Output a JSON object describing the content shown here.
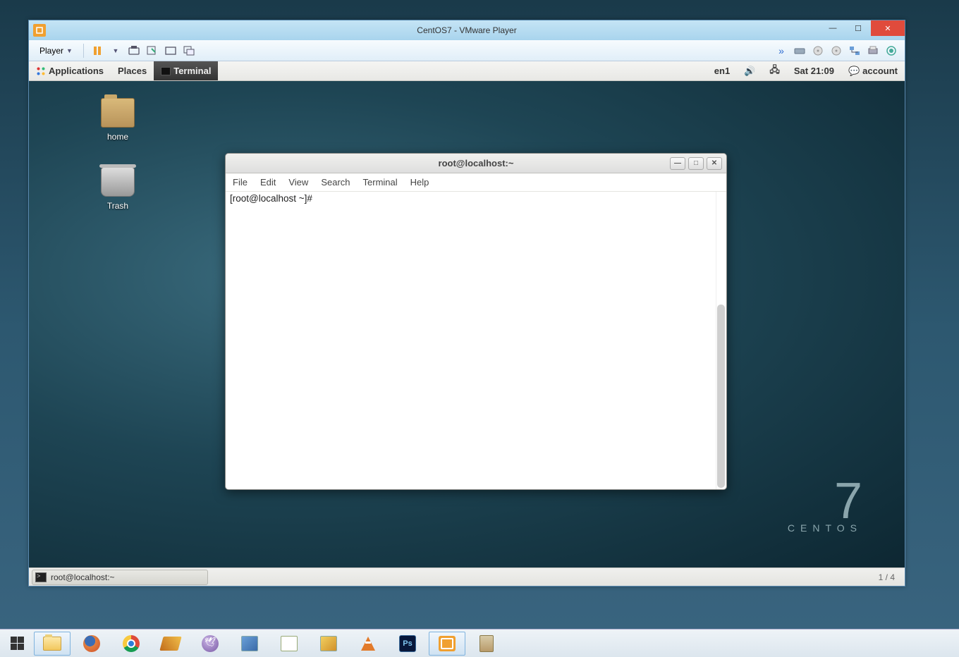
{
  "vmware": {
    "title": "CentOS7 - VMware Player",
    "player_label": "Player"
  },
  "gnome_top": {
    "applications": "Applications",
    "places": "Places",
    "terminal": "Terminal",
    "lang": "en1",
    "clock": "Sat 21:09",
    "account": "account"
  },
  "desktop_icons": {
    "home": "home",
    "trash": "Trash"
  },
  "centos_brand": {
    "ver": "7",
    "name": "CENTOS"
  },
  "terminal": {
    "title": "root@localhost:~",
    "menu": {
      "file": "File",
      "edit": "Edit",
      "view": "View",
      "search": "Search",
      "terminal": "Terminal",
      "help": "Help"
    },
    "prompt": "[root@localhost ~]# "
  },
  "gnome_bottom": {
    "task": "root@localhost:~",
    "workspace": "1 / 4"
  }
}
